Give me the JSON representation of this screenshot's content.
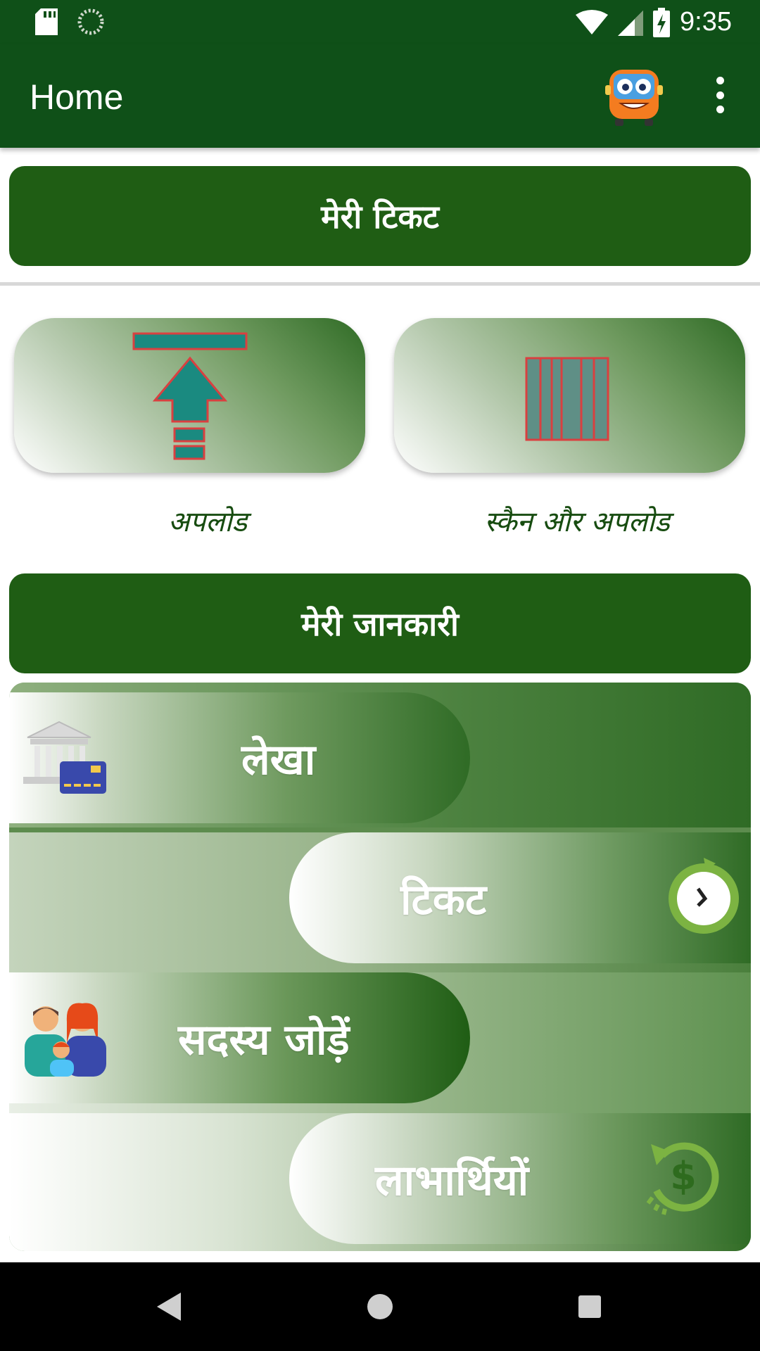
{
  "status_bar": {
    "time": "9:35",
    "icons": [
      "sd-card-icon",
      "sync-icon",
      "wifi-icon",
      "signal-icon",
      "battery-charging-icon"
    ]
  },
  "app_bar": {
    "title": "Home",
    "mascot_icon": "bus-mascot-icon",
    "menu_icon": "more-vert-icon"
  },
  "sections": {
    "my_ticket": "मेरी टिकट",
    "my_info": "मेरी जानकारी"
  },
  "tiles": {
    "upload_label": "अपलोड",
    "scan_upload_label": "स्कैन और अपलोड"
  },
  "info_items": [
    {
      "label": "लेखा",
      "icon": "bank-card-icon"
    },
    {
      "label": "टिकट",
      "icon": "timer-icon"
    },
    {
      "label": "सदस्य  जोड़ें",
      "icon": "family-icon"
    },
    {
      "label": "लाभार्थियों",
      "icon": "refund-dollar-icon"
    }
  ],
  "nav_bar": {
    "back_icon": "back-icon",
    "home_icon": "home-icon",
    "recents_icon": "recents-icon"
  },
  "colors": {
    "primary": "#0f5018",
    "section": "#1f5d14",
    "label_text": "#174c10"
  }
}
